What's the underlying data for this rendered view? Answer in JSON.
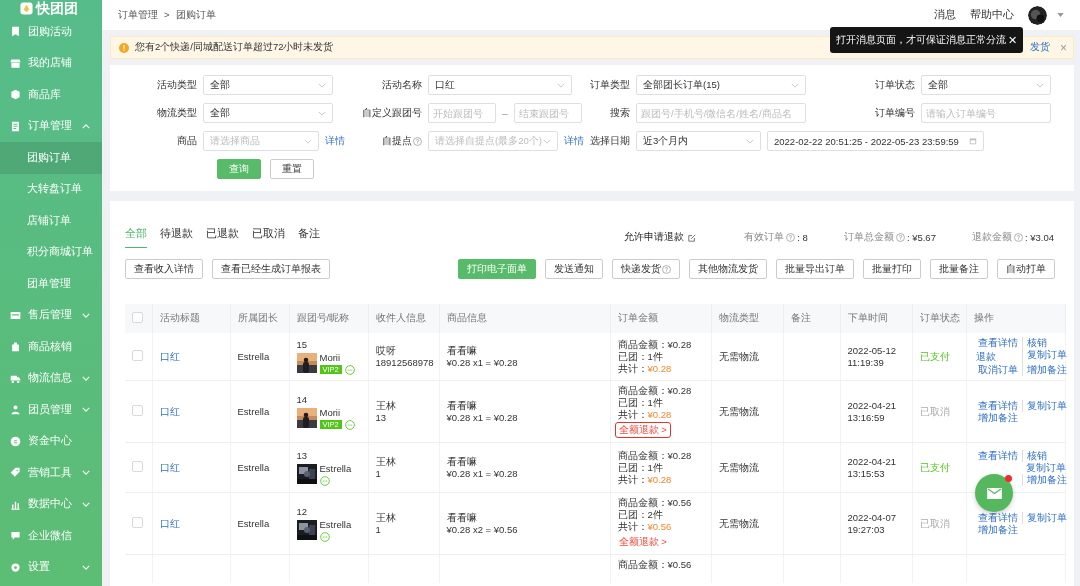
{
  "sidebar": {
    "logo": "快团团",
    "items": [
      {
        "label": "团购活动",
        "kind": "link"
      },
      {
        "label": "我的店铺",
        "kind": "link"
      },
      {
        "label": "商品库",
        "kind": "link"
      },
      {
        "label": "订单管理",
        "kind": "group",
        "expanded": true,
        "children": [
          {
            "label": "团购订单",
            "selected": true
          },
          {
            "label": "大转盘订单",
            "selected": false
          },
          {
            "label": "店铺订单",
            "selected": false
          },
          {
            "label": "积分商城订单",
            "selected": false
          },
          {
            "label": "团单管理",
            "selected": false
          }
        ]
      },
      {
        "label": "售后管理",
        "kind": "group",
        "expanded": false
      },
      {
        "label": "商品核销",
        "kind": "link"
      },
      {
        "label": "物流信息",
        "kind": "group",
        "expanded": false
      },
      {
        "label": "团员管理",
        "kind": "group",
        "expanded": false
      },
      {
        "label": "资金中心",
        "kind": "link"
      },
      {
        "label": "营销工具",
        "kind": "group",
        "expanded": false
      },
      {
        "label": "数据中心",
        "kind": "group",
        "expanded": false
      },
      {
        "label": "企业微信",
        "kind": "link"
      },
      {
        "label": "设置",
        "kind": "group",
        "expanded": false
      }
    ]
  },
  "topbar": {
    "breadcrumb": [
      "订单管理",
      "团购订单"
    ],
    "separator": ">",
    "links": [
      "消息",
      "帮助中心"
    ],
    "tooltip": {
      "text": "打开消息页面，才可保证消息正常分流",
      "close": "✕"
    }
  },
  "alert": {
    "text": "您有2个快递/同城配送订单超过72小时未发货",
    "link": "发货",
    "close": "×"
  },
  "filters": [
    [
      {
        "label": "活动类型",
        "kind": "select",
        "value": "全部"
      },
      {
        "label": "活动名称",
        "kind": "select",
        "value": "口红"
      },
      {
        "label": "订单类型",
        "kind": "select",
        "value": "全部团长订单(15)"
      },
      {
        "label": "订单状态",
        "kind": "select",
        "value": "全部"
      }
    ],
    [
      {
        "label": "物流类型",
        "kind": "select",
        "value": "全部"
      },
      {
        "label": "自定义跟团号",
        "kind": "range",
        "placeholder": "开始跟团号",
        "placeholder_end": "结束跟团号",
        "separator": "–"
      },
      {
        "label": "搜索",
        "kind": "input",
        "placeholder": "跟团号/手机号/微信名/姓名/商品名"
      },
      {
        "label": "订单编号",
        "kind": "input",
        "placeholder": "请输入订单编号"
      }
    ],
    [
      {
        "label": "商品",
        "kind": "select",
        "placeholder": "请选择商品",
        "link": "详情",
        "help": false
      },
      {
        "label": "自提点",
        "kind": "select",
        "placeholder": "请选择自提点(最多20个)",
        "link": "详情",
        "help": true
      },
      {
        "label": "选择日期",
        "kind": "date",
        "value": "近3个月内",
        "range": "2022-02-22 20:51:25 - 2022-05-23 23:59:59"
      }
    ]
  ],
  "filter_buttons": [
    {
      "label": "查询",
      "primary": true
    },
    {
      "label": "重置",
      "primary": false
    }
  ],
  "tabs": [
    {
      "label": "全部",
      "selected": true
    },
    {
      "label": "待退款",
      "selected": false
    },
    {
      "label": "已退款",
      "selected": false
    },
    {
      "label": "已取消",
      "selected": false
    },
    {
      "label": "备注",
      "selected": false
    }
  ],
  "refund_setting": "允许申请退款",
  "stats": [
    {
      "label": "有效订单",
      "value": ": 8"
    },
    {
      "label": "订单总金额",
      "value": ": ¥5.67"
    },
    {
      "label": "退款金额",
      "value": ": ¥3.04"
    }
  ],
  "actions_left": [
    "查看收入详情",
    "查看已经生成订单报表"
  ],
  "actions_right": [
    {
      "label": "打印电子面单",
      "primary": true,
      "help": false
    },
    {
      "label": "发送通知",
      "primary": false,
      "help": false
    },
    {
      "label": "快递发货",
      "primary": false,
      "help": true
    },
    {
      "label": "其他物流发货",
      "primary": false,
      "help": false
    },
    {
      "label": "批量导出订单",
      "primary": false,
      "help": false
    },
    {
      "label": "批量打印",
      "primary": false,
      "help": false
    },
    {
      "label": "批量备注",
      "primary": false,
      "help": false
    },
    {
      "label": "自动打单",
      "primary": false,
      "help": false
    }
  ],
  "table": {
    "select_all_checked": false,
    "columns": [
      "活动标题",
      "所属团长",
      "跟团号/昵称",
      "收件人信息",
      "商品信息",
      "订单金额",
      "物流类型",
      "备注",
      "下单时间",
      "订单状态",
      "操作"
    ],
    "rows": [
      {
        "checked": false,
        "activity": "口红",
        "leader": "Estrella",
        "follow_no": "15",
        "nickname": "Morii",
        "vip": "VIP2",
        "recipient_name": "哎呀",
        "recipient_phone": "18912568978",
        "product": "看看嘛",
        "product_price": "¥0.28 x1 = ¥0.28",
        "goods_amount": "商品金额：¥0.28",
        "count": "已团：1件",
        "total_label": "共计：",
        "total": "¥0.28",
        "logistics": "无需物流",
        "time": "2022-05-12 11:19:39",
        "status": {
          "text": "已支付",
          "kind": "paid"
        },
        "operations": [
          {
            "label": "查看详情",
            "kind": "view"
          },
          {
            "label": "核销",
            "kind": "verify"
          },
          {
            "label": "退款",
            "kind": "refund"
          },
          {
            "label": "复制订单",
            "kind": "copy"
          },
          {
            "label": "取消订单",
            "kind": "cancel"
          },
          {
            "label": "增加备注",
            "kind": "remark"
          }
        ]
      },
      {
        "checked": false,
        "activity": "口红",
        "leader": "Estrella",
        "follow_no": "14",
        "nickname": "Morii",
        "vip": "VIP2",
        "recipient_name": "王林",
        "recipient_phone": "13",
        "product": "看看嘛",
        "product_price": "¥0.28 x1 = ¥0.28",
        "goods_amount": "商品金额：¥0.28",
        "count": "已团：1件",
        "total_label": "共计：",
        "total": "¥0.28",
        "refund": {
          "label": "全额退款 >",
          "outlined": true
        },
        "logistics": "无需物流",
        "time": "2022-04-21 13:16:59",
        "status": {
          "text": "已取消",
          "kind": "cancelled"
        },
        "operations": [
          {
            "label": "查看详情",
            "kind": "view"
          },
          {
            "label": "复制订单",
            "kind": "copy"
          },
          {
            "label": "增加备注",
            "kind": "remark"
          }
        ]
      },
      {
        "checked": false,
        "activity": "口红",
        "leader": "Estrella",
        "follow_no": "13",
        "nickname": "Estrella",
        "recipient_name": "王林",
        "recipient_phone": "1",
        "product": "看看嘛",
        "product_price": "¥0.28 x1 = ¥0.28",
        "goods_amount": "商品金额：¥0.28",
        "count": "已团：1件",
        "total_label": "共计：",
        "total": "¥0.28",
        "logistics": "无需物流",
        "time": "2022-04-21 13:15:53",
        "status": {
          "text": "已支付",
          "kind": "paid"
        },
        "operations": [
          {
            "label": "查看详情",
            "kind": "view"
          },
          {
            "label": "核销",
            "kind": "verify"
          },
          {
            "label": "复制订单",
            "kind": "copy"
          },
          {
            "label": "增加备注",
            "kind": "remark"
          }
        ]
      },
      {
        "checked": false,
        "activity": "口红",
        "leader": "Estrella",
        "follow_no": "12",
        "nickname": "Estrella",
        "recipient_name": "王林",
        "recipient_phone": "1",
        "product": "看看嘛",
        "product_price": "¥0.28 x2 = ¥0.56",
        "goods_amount": "商品金额：¥0.56",
        "count": "已团：2件",
        "total_label": "共计：",
        "total": "¥0.56",
        "refund": {
          "label": "全额退款 >",
          "outlined": false
        },
        "logistics": "无需物流",
        "time": "2022-04-07 19:27:03",
        "status": {
          "text": "已取消",
          "kind": "cancelled"
        },
        "operations": [
          {
            "label": "查看详情",
            "kind": "view"
          },
          {
            "label": "复制订单",
            "kind": "copy"
          },
          {
            "label": "增加备注",
            "kind": "remark"
          }
        ]
      }
    ],
    "partial_row": {
      "goods_amount": "商品金额：¥0.56"
    }
  },
  "message_fab": {
    "unread": true
  }
}
